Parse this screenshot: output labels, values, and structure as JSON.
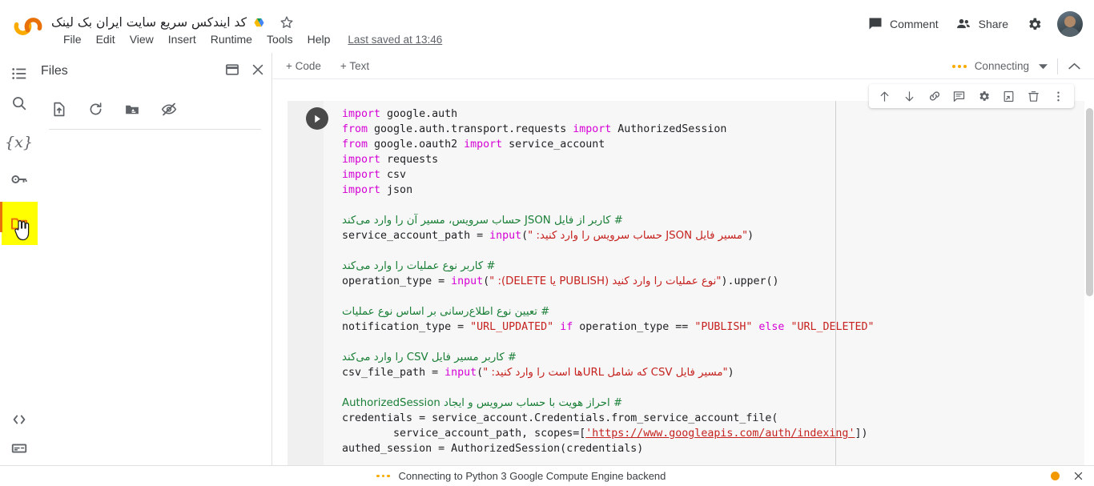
{
  "app": {
    "logo_name": "colab-logo",
    "doc_title": "کد ایندکس سریع سایت ایران بک لینک",
    "last_saved": "Last saved at 13:46"
  },
  "menubar": {
    "items": [
      {
        "label": "File"
      },
      {
        "label": "Edit"
      },
      {
        "label": "View"
      },
      {
        "label": "Insert"
      },
      {
        "label": "Runtime"
      },
      {
        "label": "Tools"
      },
      {
        "label": "Help"
      }
    ]
  },
  "topright": {
    "comment_label": "Comment",
    "share_label": "Share",
    "settings_icon": "gear-icon",
    "avatar_name": "user-avatar"
  },
  "files_panel": {
    "title": "Files",
    "header_icons": [
      "open-in-new-window-icon",
      "close-icon"
    ],
    "toolbar_icons": [
      "upload-file-icon",
      "refresh-icon",
      "mount-drive-icon",
      "toggle-hidden-files-icon"
    ]
  },
  "rail": {
    "items": [
      {
        "name": "table-of-contents-icon",
        "active": false
      },
      {
        "name": "search-icon",
        "active": false
      },
      {
        "name": "variables-icon",
        "active": false,
        "label": "{x}"
      },
      {
        "name": "secrets-key-icon",
        "active": false
      },
      {
        "name": "files-folder-icon",
        "active": true
      },
      {
        "name": "code-snippets-icon",
        "active": false
      },
      {
        "name": "terminal-icon",
        "active": false
      }
    ],
    "highlight_color": "#ffff00",
    "active_color": "#e8710a"
  },
  "notebook_toolbar": {
    "add_code": "+ Code",
    "add_text": "+ Text",
    "connection_status": "Connecting",
    "caret_icon": "chevron-down-icon",
    "collapse_icon": "chevron-up-icon"
  },
  "cell_toolbar": {
    "buttons": [
      "move-cell-up-icon",
      "move-cell-down-icon",
      "link-to-cell-icon",
      "add-comment-icon",
      "cell-settings-icon",
      "mirror-cell-icon",
      "delete-cell-icon",
      "more-options-icon"
    ]
  },
  "cell": {
    "run_button": "run-cell-button",
    "code_lines": [
      {
        "tokens": [
          {
            "t": "import ",
            "c": "kw"
          },
          {
            "t": "google.auth",
            "c": "fn"
          }
        ]
      },
      {
        "tokens": [
          {
            "t": "from ",
            "c": "kw"
          },
          {
            "t": "google.auth.transport.requests ",
            "c": "fn"
          },
          {
            "t": "import ",
            "c": "kw"
          },
          {
            "t": "AuthorizedSession",
            "c": "fn"
          }
        ]
      },
      {
        "tokens": [
          {
            "t": "from ",
            "c": "kw"
          },
          {
            "t": "google.oauth2 ",
            "c": "fn"
          },
          {
            "t": "import ",
            "c": "kw"
          },
          {
            "t": "service_account",
            "c": "fn"
          }
        ]
      },
      {
        "tokens": [
          {
            "t": "import ",
            "c": "kw"
          },
          {
            "t": "requests",
            "c": "fn"
          }
        ]
      },
      {
        "tokens": [
          {
            "t": "import ",
            "c": "kw"
          },
          {
            "t": "csv",
            "c": "fn"
          }
        ]
      },
      {
        "tokens": [
          {
            "t": "import ",
            "c": "kw"
          },
          {
            "t": "json",
            "c": "fn"
          }
        ]
      },
      {
        "tokens": []
      },
      {
        "tokens": [
          {
            "t": "# کاربر از فایل JSON حساب سرویس، مسیر آن را وارد می‌کند",
            "c": "cm"
          }
        ]
      },
      {
        "tokens": [
          {
            "t": "service_account_path = ",
            "c": "fn"
          },
          {
            "t": "input",
            "c": "kw"
          },
          {
            "t": "(",
            "c": "fn"
          },
          {
            "t": "\"مسیر فایل JSON حساب سرویس را وارد کنید: \"",
            "c": "strfa"
          },
          {
            "t": ")",
            "c": "fn"
          }
        ]
      },
      {
        "tokens": []
      },
      {
        "tokens": [
          {
            "t": "# کاربر نوع عملیات را وارد می‌کند",
            "c": "cm"
          }
        ]
      },
      {
        "tokens": [
          {
            "t": "operation_type = ",
            "c": "fn"
          },
          {
            "t": "input",
            "c": "kw"
          },
          {
            "t": "(",
            "c": "fn"
          },
          {
            "t": "\"نوع عملیات را وارد کنید (PUBLISH یا DELETE): \"",
            "c": "strfa"
          },
          {
            "t": ").upper()",
            "c": "fn"
          }
        ]
      },
      {
        "tokens": []
      },
      {
        "tokens": [
          {
            "t": "# تعیین نوع اطلاع‌رسانی بر اساس نوع عملیات",
            "c": "cm"
          }
        ]
      },
      {
        "tokens": [
          {
            "t": "notification_type = ",
            "c": "fn"
          },
          {
            "t": "\"URL_UPDATED\"",
            "c": "str"
          },
          {
            "t": " ",
            "c": "fn"
          },
          {
            "t": "if",
            "c": "kw"
          },
          {
            "t": " operation_type == ",
            "c": "fn"
          },
          {
            "t": "\"PUBLISH\"",
            "c": "str"
          },
          {
            "t": " ",
            "c": "fn"
          },
          {
            "t": "else",
            "c": "kw"
          },
          {
            "t": " ",
            "c": "fn"
          },
          {
            "t": "\"URL_DELETED\"",
            "c": "str"
          }
        ]
      },
      {
        "tokens": []
      },
      {
        "tokens": [
          {
            "t": "# کاربر مسیر فایل CSV را وارد می‌کند",
            "c": "cm"
          }
        ]
      },
      {
        "tokens": [
          {
            "t": "csv_file_path = ",
            "c": "fn"
          },
          {
            "t": "input",
            "c": "kw"
          },
          {
            "t": "(",
            "c": "fn"
          },
          {
            "t": "\"مسیر فایل CSV که شامل URLها است را وارد کنید: \"",
            "c": "strfa"
          },
          {
            "t": ")",
            "c": "fn"
          }
        ]
      },
      {
        "tokens": []
      },
      {
        "tokens": [
          {
            "t": "# احراز هویت با حساب سرویس و ایجاد AuthorizedSession",
            "c": "cm"
          }
        ]
      },
      {
        "tokens": [
          {
            "t": "credentials = service_account.Credentials.from_service_account_file(",
            "c": "fn"
          }
        ]
      },
      {
        "tokens": [
          {
            "t": "        service_account_path, scopes=[",
            "c": "fn"
          },
          {
            "t": "'https://www.googleapis.com/auth/indexing'",
            "c": "url"
          },
          {
            "t": "])",
            "c": "fn"
          }
        ]
      },
      {
        "tokens": [
          {
            "t": "authed_session = AuthorizedSession(credentials)",
            "c": "fn"
          }
        ]
      }
    ]
  },
  "statusbar": {
    "text": "Connecting to Python 3 Google Compute Engine backend",
    "indicator_color": "#f29900",
    "close_icon": "close-icon"
  }
}
